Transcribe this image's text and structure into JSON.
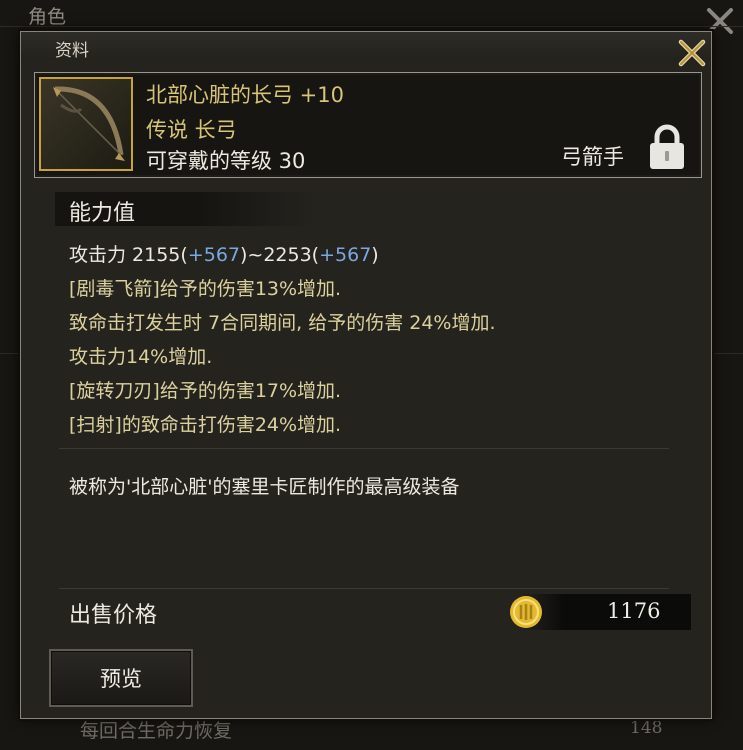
{
  "background_window": {
    "title": "角色",
    "bottom_text": "每回合生命力恢复",
    "bottom_value": "148"
  },
  "panel": {
    "title": "资料"
  },
  "item": {
    "name": "北部心脏的长弓 +10",
    "grade_type": "传说 长弓",
    "level_req": "可穿戴的等级 30",
    "class": "弓箭手",
    "icon": "longbow-icon",
    "icon_border_color": "#c9a33a"
  },
  "stats_section": {
    "title": "能力值",
    "attack_label": "攻击力 2155(",
    "attack_bonus1": "+567",
    "attack_mid": ")~2253(",
    "attack_bonus2": "+567",
    "attack_end": ")",
    "lines": [
      "[剧毒飞箭]给予的伤害13%增加.",
      "致命击打发生时 7合同期间, 给予的伤害 24%增加.",
      "攻击力14%增加.",
      "[旋转刀刃]给予的伤害17%增加.",
      "[扫射]的致命击打伤害24%增加."
    ]
  },
  "description": "被称为'北部心脏'的塞里卡匠制作的最高级装备",
  "price": {
    "label": "出售价格",
    "value": "1176",
    "icon": "gold-coin-icon"
  },
  "buttons": {
    "preview": "预览"
  },
  "colors": {
    "item_name": "#d8c477",
    "bonus_blue": "#7aa8df",
    "stat_yellow": "#dcd19e"
  }
}
